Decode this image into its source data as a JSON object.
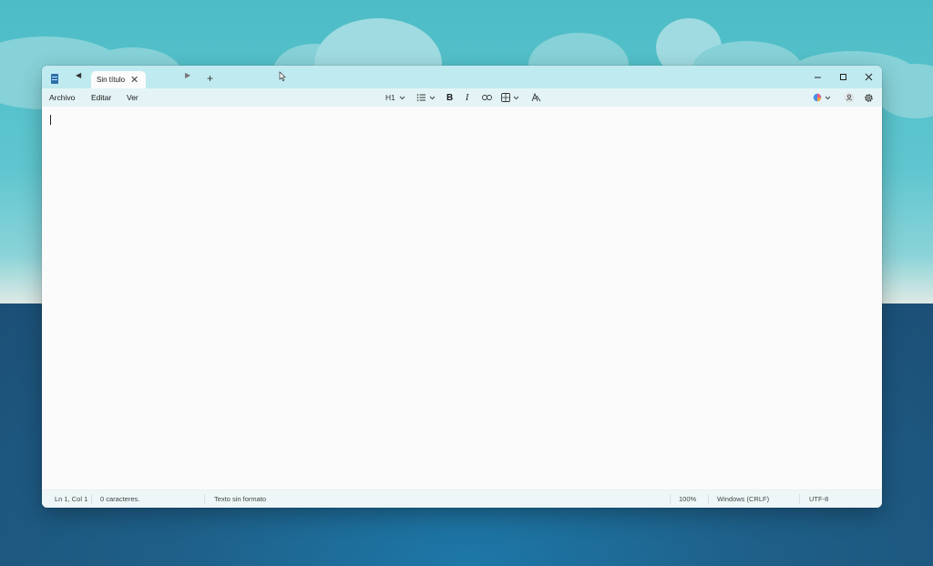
{
  "tab": {
    "title": "Sin título"
  },
  "menu": {
    "items": [
      "Archivo",
      "Editar",
      "Ver"
    ]
  },
  "toolbar": {
    "heading_label": "H1"
  },
  "status": {
    "position": "Ln 1, Col 1",
    "characters": "0 caracteres.",
    "format": "Texto sin formato",
    "zoom": "100%",
    "line_ending": "Windows (CRLF)",
    "encoding": "UTF-8"
  },
  "icons": {
    "app": "notepad-icon",
    "tab_scroll_left": "chevron-left-icon",
    "tab_scroll_right": "chevron-right-icon",
    "tab_close": "close-icon",
    "new_tab": "plus-icon",
    "minimize": "minimize-icon",
    "maximize": "maximize-icon",
    "close": "close-icon",
    "list": "list-icon",
    "bold": "bold-icon",
    "italic": "italic-icon",
    "link": "link-icon",
    "table": "table-icon",
    "clear_format": "clear-formatting-icon",
    "copilot": "copilot-icon",
    "account": "account-icon",
    "settings": "gear-icon"
  },
  "colors": {
    "titlebar": "#bfeaf0",
    "menubar": "#e4f4f6",
    "editor": "#fbfbfb",
    "statusbar": "#eef6f8"
  }
}
